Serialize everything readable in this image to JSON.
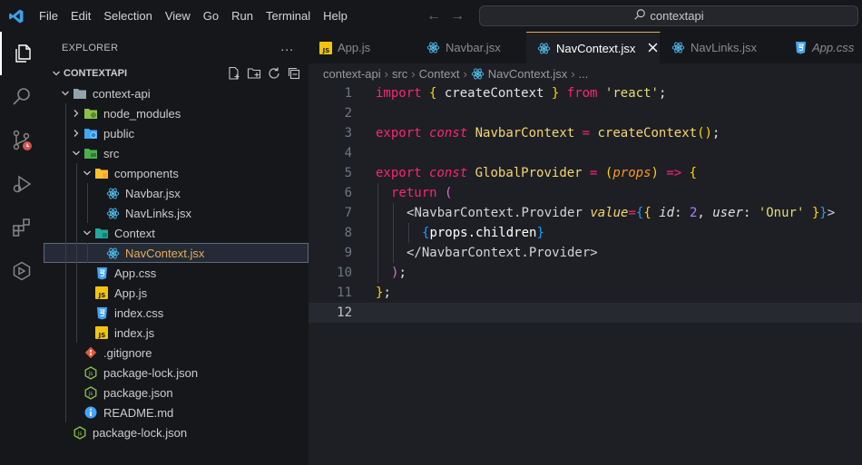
{
  "menu": [
    "File",
    "Edit",
    "Selection",
    "View",
    "Go",
    "Run",
    "Terminal",
    "Help"
  ],
  "search": {
    "text": "contextapi"
  },
  "explorer": {
    "title": "EXPLORER",
    "more": "...",
    "section": "CONTEXTAPI",
    "tree": [
      {
        "label": "context-api",
        "depth": 1,
        "type": "folder-open",
        "chev": "down"
      },
      {
        "label": "node_modules",
        "depth": 2,
        "type": "folder-node",
        "chev": "right"
      },
      {
        "label": "public",
        "depth": 2,
        "type": "folder-public",
        "chev": "right"
      },
      {
        "label": "src",
        "depth": 2,
        "type": "folder-src",
        "chev": "down"
      },
      {
        "label": "components",
        "depth": 3,
        "type": "folder-comp",
        "chev": "down"
      },
      {
        "label": "Navbar.jsx",
        "depth": 4,
        "type": "react"
      },
      {
        "label": "NavLinks.jsx",
        "depth": 4,
        "type": "react"
      },
      {
        "label": "Context",
        "depth": 3,
        "type": "folder-ctx",
        "chev": "down"
      },
      {
        "label": "NavContext.jsx",
        "depth": 4,
        "type": "react",
        "selected": true
      },
      {
        "label": "App.css",
        "depth": 3,
        "type": "css"
      },
      {
        "label": "App.js",
        "depth": 3,
        "type": "js"
      },
      {
        "label": "index.css",
        "depth": 3,
        "type": "css"
      },
      {
        "label": "index.js",
        "depth": 3,
        "type": "js"
      },
      {
        "label": ".gitignore",
        "depth": 2,
        "type": "git"
      },
      {
        "label": "package-lock.json",
        "depth": 2,
        "type": "node"
      },
      {
        "label": "package.json",
        "depth": 2,
        "type": "node"
      },
      {
        "label": "README.md",
        "depth": 2,
        "type": "info"
      },
      {
        "label": "package-lock.json",
        "depth": 1,
        "type": "node"
      }
    ]
  },
  "tabs": [
    {
      "label": "App.js",
      "icon": "js"
    },
    {
      "label": "Navbar.jsx",
      "icon": "react"
    },
    {
      "label": "NavContext.jsx",
      "icon": "react",
      "active": true
    },
    {
      "label": "NavLinks.jsx",
      "icon": "react"
    },
    {
      "label": "App.css",
      "icon": "css"
    }
  ],
  "breadcrumb": [
    "context-api",
    "src",
    "Context",
    "NavContext.jsx",
    "..."
  ],
  "code": {
    "line_numbers": [
      "1",
      "2",
      "3",
      "4",
      "5",
      "6",
      "7",
      "8",
      "9",
      "10",
      "11",
      "12"
    ],
    "current_line": 12,
    "l1": {
      "kw": "import",
      "b1": "{",
      "name": " createContext ",
      "b2": "}",
      "from": "from",
      "str": "'react'",
      "end": ";"
    },
    "l3": {
      "kw": "export",
      "kw2": "const",
      "name": "NavbarContext",
      "eq": " = ",
      "fn": "createContext",
      "b1": "(",
      "b2": ")",
      "end": ";"
    },
    "l5": {
      "kw": "export",
      "kw2": "const",
      "name": "GlobalProvider",
      "eq": " = ",
      "b1": "(",
      "prm": "props",
      "b2": ")",
      "arrow": " => ",
      "b3": "{"
    },
    "l6": {
      "kw": "return",
      "b": "("
    },
    "l7": {
      "open": "<",
      "tag": "NavbarContext.Provider",
      "attr": "value",
      "eq": "=",
      "b1": "{",
      "b2": "{",
      "k1": "id",
      "c1": ": ",
      "v1": "2",
      "comma": ", ",
      "k2": "user",
      "c2": ": ",
      "v2": "'Onur'",
      "b3": "}",
      "b4": "}",
      "close": ">"
    },
    "l8": {
      "b1": "{",
      "expr": "props.children",
      "b2": "}"
    },
    "l9": {
      "open": "</",
      "tag": "NavbarContext.Provider",
      "close": ">"
    },
    "l10": {
      "b": ")",
      "end": ";"
    },
    "l11": {
      "b": "}",
      "end": ";"
    }
  },
  "colors": {
    "accent": "#e8ab53",
    "react": "#4fc3f7",
    "js": "#f1c40f",
    "css": "#42a5f5"
  }
}
